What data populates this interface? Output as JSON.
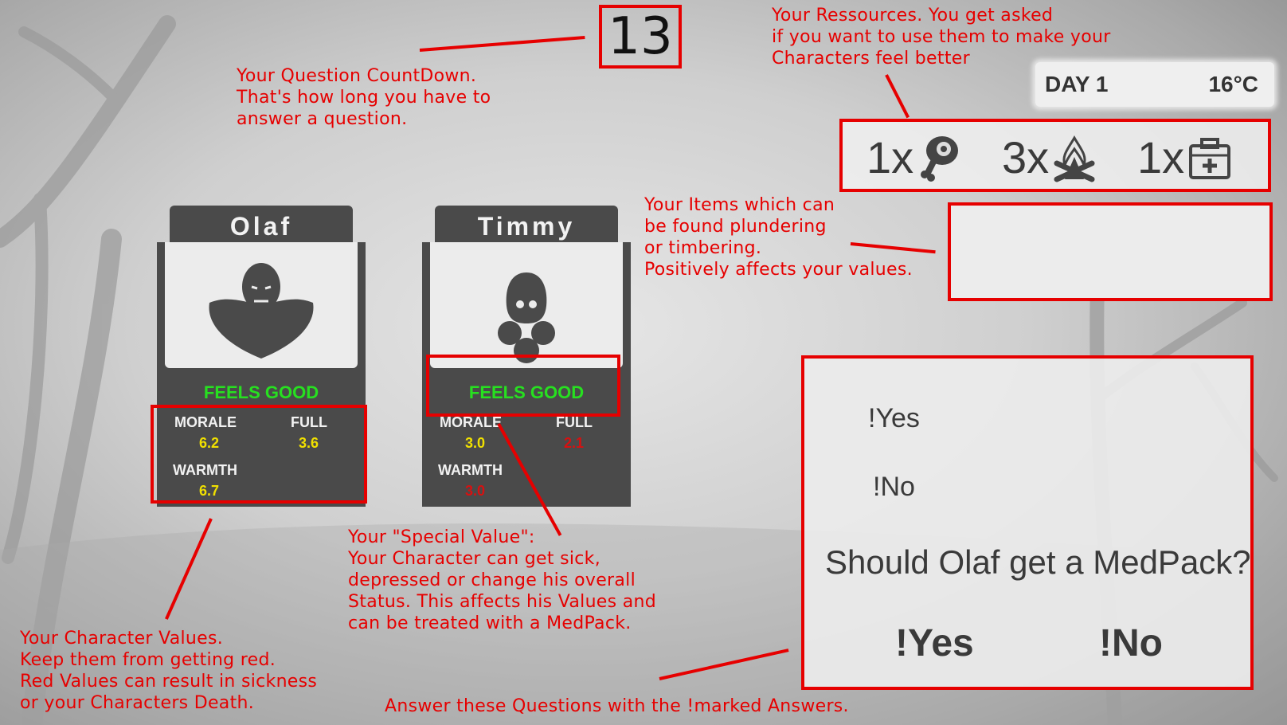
{
  "countdown": "13",
  "notes": {
    "countdown": "Your Question CountDown.\nThat's how long you have to\nanswer a question.",
    "resources": "Your Ressources. You get asked\nif you want to use them to make your\nCharacters feel better",
    "items": "Your Items which can\nbe found plundering\nor timbering.\nPositively affects your values.",
    "special": "Your \"Special Value\":\nYour Character can get sick,\ndepressed or change his overall\nStatus. This affects his Values and\ncan be treated with a MedPack.",
    "values": "Your Character Values.\nKeep them from getting red.\nRed Values can result in sickness\nor your Characters Death.",
    "answer": "Answer these Questions with the !marked Answers."
  },
  "hud": {
    "day": "DAY 1",
    "temperature": "16°C"
  },
  "resources": [
    {
      "count": "1x",
      "icon": "meat-icon"
    },
    {
      "count": "3x",
      "icon": "campfire-icon"
    },
    {
      "count": "1x",
      "icon": "medpack-icon"
    }
  ],
  "characters": [
    {
      "name": "Olaf",
      "portrait_icon": "hulk-portrait-icon",
      "status": "FEELS GOOD",
      "stats": [
        {
          "label": "MORALE",
          "value": "6.2",
          "level": "ok"
        },
        {
          "label": "FULL",
          "value": "3.6",
          "level": "ok"
        },
        {
          "label": "WARMTH",
          "value": "6.7",
          "level": "ok"
        }
      ]
    },
    {
      "name": "Timmy",
      "portrait_icon": "ghost-portrait-icon",
      "status": "FEELS GOOD",
      "stats": [
        {
          "label": "MORALE",
          "value": "3.0",
          "level": "ok"
        },
        {
          "label": "FULL",
          "value": "2.1",
          "level": "low"
        },
        {
          "label": "WARMTH",
          "value": "3.0",
          "level": "low"
        }
      ]
    }
  ],
  "question": {
    "options": [
      "!Yes",
      "!No"
    ],
    "text": "Should Olaf get a MedPack?",
    "answers": [
      "!Yes",
      "!No"
    ]
  },
  "colors": {
    "annotation": "#e60000",
    "ok": "#f0e000",
    "low": "#d81010",
    "status": "#27e020",
    "panel": "#4a4a4a"
  }
}
